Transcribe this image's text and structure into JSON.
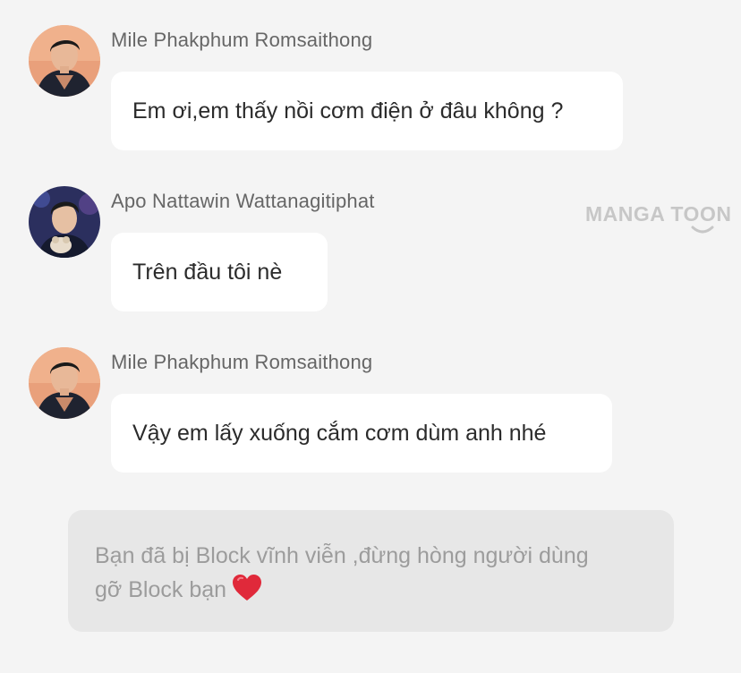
{
  "messages": [
    {
      "sender": "Mile Phakphum Romsaithong",
      "text": "Em ơi,em thấy nồi cơm điện ở đâu không ?"
    },
    {
      "sender": "Apo Nattawin Wattanagitiphat",
      "text": "Trên đầu tôi nè"
    },
    {
      "sender": "Mile Phakphum Romsaithong",
      "text": "Vậy em lấy xuống cắm cơm dùm anh nhé"
    }
  ],
  "watermark": {
    "text": "MANGA TOON"
  },
  "notice": {
    "line1": "Bạn đã bị Block vĩnh viễn ,đừng hòng người dùng",
    "line2": "gỡ Block bạn",
    "icon": "heart-icon",
    "icon_color": "#e0293a"
  },
  "colors": {
    "background": "#f4f4f4",
    "bubble": "#ffffff",
    "notice_bg": "#e7e7e7",
    "sender_text": "#666666",
    "notice_text": "#9c9c9c"
  }
}
